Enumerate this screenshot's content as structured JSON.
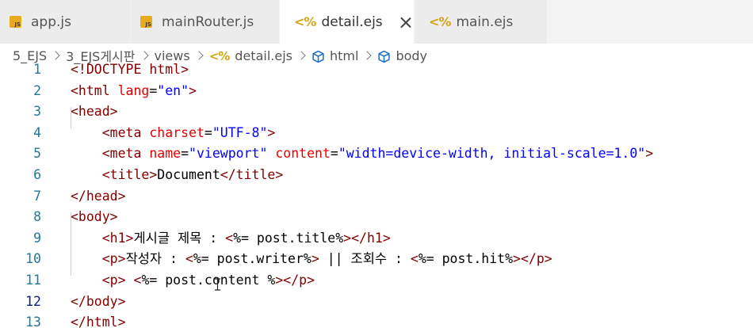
{
  "tabs": [
    {
      "label": "app.js",
      "icon": "js-file-icon",
      "active": false
    },
    {
      "label": "mainRouter.js",
      "icon": "js-file-icon",
      "active": false
    },
    {
      "label": "detail.ejs",
      "icon": "ejs-file-icon",
      "active": true
    },
    {
      "label": "main.ejs",
      "icon": "ejs-file-icon",
      "active": false
    }
  ],
  "icons": {
    "js_badge": "JS",
    "ejs_badge": "<%"
  },
  "breadcrumb": {
    "items": [
      "5_EJS",
      "3_EJS게시판",
      "views",
      "detail.ejs",
      "html",
      "body"
    ]
  },
  "colors": {
    "tag": "#800000",
    "attribute": "#e50000",
    "string": "#0000ff",
    "line_number": "#237893",
    "ejs_icon": "#d4a417",
    "js_icon": "#e8ab20"
  },
  "editor": {
    "current_line": "12",
    "lines": [
      {
        "num": "1",
        "tokens": [
          {
            "c": "t",
            "v": "<!DOCTYPE html>"
          }
        ]
      },
      {
        "num": "2",
        "tokens": [
          {
            "c": "t",
            "v": "<html"
          },
          {
            "c": "p",
            "v": " "
          },
          {
            "c": "a",
            "v": "lang"
          },
          {
            "c": "p",
            "v": "="
          },
          {
            "c": "s",
            "v": "\"en\""
          },
          {
            "c": "t",
            "v": ">"
          }
        ]
      },
      {
        "num": "3",
        "tokens": [
          {
            "c": "t",
            "v": "<head>"
          }
        ]
      },
      {
        "num": "4",
        "tokens": [
          {
            "c": "p",
            "v": "    "
          },
          {
            "c": "t",
            "v": "<meta"
          },
          {
            "c": "p",
            "v": " "
          },
          {
            "c": "a",
            "v": "charset"
          },
          {
            "c": "p",
            "v": "="
          },
          {
            "c": "s",
            "v": "\"UTF-8\""
          },
          {
            "c": "t",
            "v": ">"
          }
        ]
      },
      {
        "num": "5",
        "tokens": [
          {
            "c": "p",
            "v": "    "
          },
          {
            "c": "t",
            "v": "<meta"
          },
          {
            "c": "p",
            "v": " "
          },
          {
            "c": "a",
            "v": "name"
          },
          {
            "c": "p",
            "v": "="
          },
          {
            "c": "s",
            "v": "\"viewport\""
          },
          {
            "c": "p",
            "v": " "
          },
          {
            "c": "a",
            "v": "content"
          },
          {
            "c": "p",
            "v": "="
          },
          {
            "c": "s",
            "v": "\"width=device-width, initial-scale=1.0\""
          },
          {
            "c": "t",
            "v": ">"
          }
        ]
      },
      {
        "num": "6",
        "tokens": [
          {
            "c": "p",
            "v": "    "
          },
          {
            "c": "t",
            "v": "<title>"
          },
          {
            "c": "p",
            "v": "Document"
          },
          {
            "c": "t",
            "v": "</title>"
          }
        ]
      },
      {
        "num": "7",
        "tokens": [
          {
            "c": "t",
            "v": "</head>"
          }
        ]
      },
      {
        "num": "8",
        "tokens": [
          {
            "c": "t",
            "v": "<body>"
          }
        ]
      },
      {
        "num": "9",
        "tokens": [
          {
            "c": "p",
            "v": "    "
          },
          {
            "c": "t",
            "v": "<h1>"
          },
          {
            "c": "p",
            "v": "게시글 제목 : "
          },
          {
            "c": "t",
            "v": "<"
          },
          {
            "c": "p",
            "v": "%= post.title%"
          },
          {
            "c": "t",
            "v": "></h1>"
          }
        ]
      },
      {
        "num": "10",
        "tokens": [
          {
            "c": "p",
            "v": "    "
          },
          {
            "c": "t",
            "v": "<p>"
          },
          {
            "c": "p",
            "v": "작성자 : "
          },
          {
            "c": "t",
            "v": "<"
          },
          {
            "c": "p",
            "v": "%= post.writer%"
          },
          {
            "c": "t",
            "v": ">"
          },
          {
            "c": "p",
            "v": " || 조회수 : "
          },
          {
            "c": "t",
            "v": "<"
          },
          {
            "c": "p",
            "v": "%= post.hit%"
          },
          {
            "c": "t",
            "v": "></p>"
          }
        ]
      },
      {
        "num": "11",
        "tokens": [
          {
            "c": "p",
            "v": "    "
          },
          {
            "c": "t",
            "v": "<p>"
          },
          {
            "c": "p",
            "v": " "
          },
          {
            "c": "t",
            "v": "<"
          },
          {
            "c": "p",
            "v": "%= post.content %"
          },
          {
            "c": "t",
            "v": "></p>"
          }
        ]
      },
      {
        "num": "12",
        "tokens": [
          {
            "c": "t",
            "v": "</body>"
          }
        ]
      },
      {
        "num": "13",
        "tokens": [
          {
            "c": "t",
            "v": "</html>"
          }
        ]
      }
    ]
  }
}
